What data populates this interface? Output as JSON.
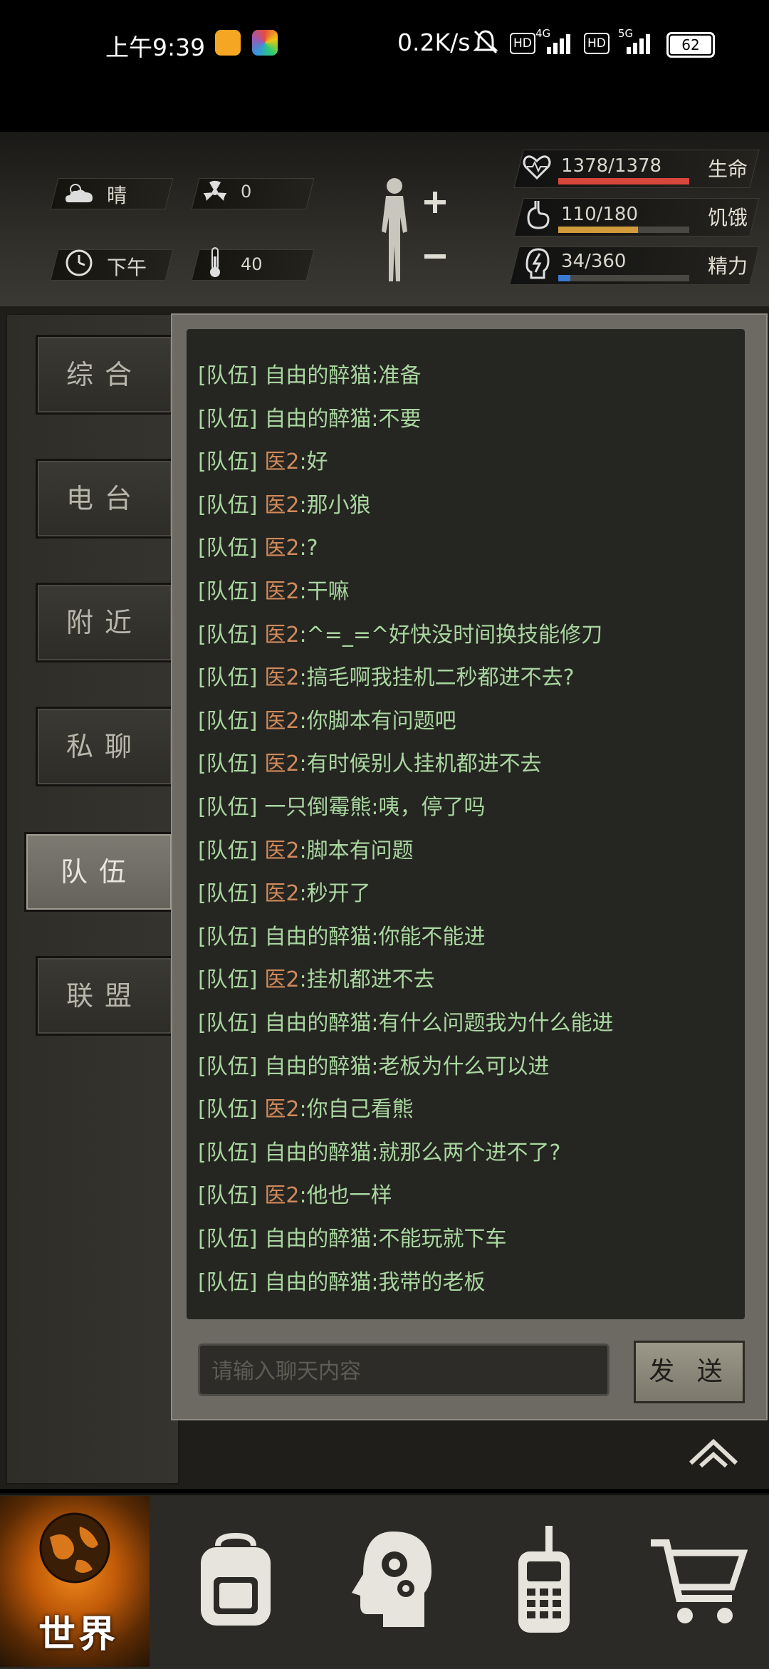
{
  "status_bar": {
    "time": "上午9:39",
    "speed": "0.2K/s",
    "hd1": "HD",
    "net1": "4G",
    "hd2": "HD",
    "net2": "5G",
    "battery": "62"
  },
  "stats": {
    "weather": "晴",
    "radiation": "0",
    "time_of_day": "下午",
    "temperature": "40",
    "health": {
      "label": "生命",
      "value": "1378/1378",
      "fraction": 1.0,
      "color": "#d9463c"
    },
    "hunger": {
      "label": "饥饿",
      "value": "110/180",
      "fraction": 0.61,
      "color": "#d19a3a"
    },
    "energy": {
      "label": "精力",
      "value": "34/360",
      "fraction": 0.094,
      "color": "#3a7ad1"
    }
  },
  "tabs": [
    {
      "label": "综合"
    },
    {
      "label": "电台"
    },
    {
      "label": "附近"
    },
    {
      "label": "私聊"
    },
    {
      "label": "队伍",
      "active": true
    },
    {
      "label": "联盟"
    }
  ],
  "chat": {
    "channel": "[队伍]",
    "messages": [
      {
        "name": "自由的醉猫",
        "text": ":准备",
        "medic": false
      },
      {
        "name": "自由的醉猫",
        "text": ":不要",
        "medic": false
      },
      {
        "name": "医2",
        "text": ":好",
        "medic": true
      },
      {
        "name": "医2",
        "text": ":那小狼",
        "medic": true
      },
      {
        "name": "医2",
        "text": ":?",
        "medic": true
      },
      {
        "name": "医2",
        "text": ":干嘛",
        "medic": true
      },
      {
        "name": "医2",
        "text": ":^=_=^好快没时间换技能修刀",
        "medic": true
      },
      {
        "name": "医2",
        "text": ":搞毛啊我挂机二秒都进不去?",
        "medic": true
      },
      {
        "name": "医2",
        "text": ":你脚本有问题吧",
        "medic": true
      },
      {
        "name": "医2",
        "text": ":有时候别人挂机都进不去",
        "medic": true
      },
      {
        "name": "一只倒霉熊",
        "text": ":咦，停了吗",
        "medic": false
      },
      {
        "name": "医2",
        "text": ":脚本有问题",
        "medic": true
      },
      {
        "name": "医2",
        "text": ":秒开了",
        "medic": true
      },
      {
        "name": "自由的醉猫",
        "text": ":你能不能进",
        "medic": false
      },
      {
        "name": "医2",
        "text": ":挂机都进不去",
        "medic": true
      },
      {
        "name": "自由的醉猫",
        "text": ":有什么问题我为什么能进",
        "medic": false
      },
      {
        "name": "自由的醉猫",
        "text": ":老板为什么可以进",
        "medic": false
      },
      {
        "name": "医2",
        "text": ":你自己看熊",
        "medic": true
      },
      {
        "name": "自由的醉猫",
        "text": ":就那么两个进不了?",
        "medic": false
      },
      {
        "name": "医2",
        "text": ":他也一样",
        "medic": true
      },
      {
        "name": "自由的醉猫",
        "text": ":不能玩就下车",
        "medic": false
      },
      {
        "name": "自由的醉猫",
        "text": ":我带的老板",
        "medic": false
      }
    ],
    "input_placeholder": "请输入聊天内容",
    "send_label": "发 送"
  },
  "bottom_nav": {
    "world_label": "世界",
    "items": [
      "backpack-icon",
      "skills-head-icon",
      "radio-icon",
      "shop-cart-icon"
    ]
  }
}
